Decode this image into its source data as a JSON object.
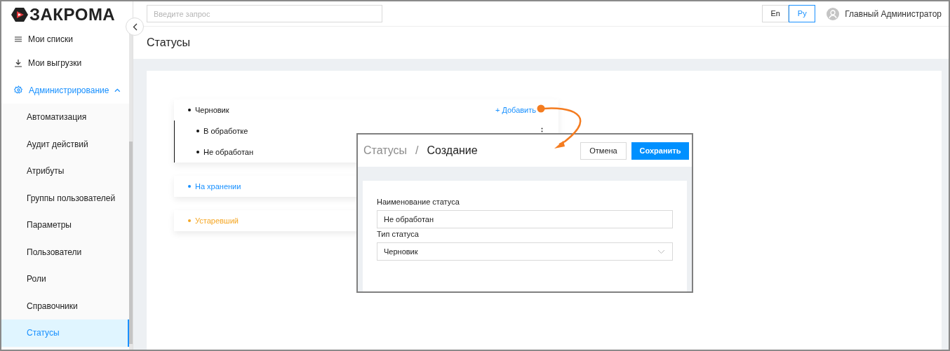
{
  "logo": {
    "text": "ЗАКРОМА"
  },
  "search": {
    "placeholder": "Введите запрос"
  },
  "languages": [
    {
      "label": "En",
      "selected": false
    },
    {
      "label": "Ру",
      "selected": true
    }
  ],
  "user": {
    "name": "Главный Администратор"
  },
  "sidebar": {
    "items": [
      {
        "label": "Мои списки",
        "kind": "list",
        "selected": false
      },
      {
        "label": "Мои выгрузки",
        "kind": "download",
        "selected": false
      },
      {
        "label": "Администрирование",
        "kind": "group",
        "selected": true,
        "expanded": true,
        "children": [
          {
            "label": "Автоматизация",
            "selected": false
          },
          {
            "label": "Аудит действий",
            "selected": false
          },
          {
            "label": "Атрибуты",
            "selected": false
          },
          {
            "label": "Группы пользователей",
            "selected": false
          },
          {
            "label": "Параметры",
            "selected": false
          },
          {
            "label": "Пользователи",
            "selected": false
          },
          {
            "label": "Роли",
            "selected": false
          },
          {
            "label": "Справочники",
            "selected": false
          },
          {
            "label": "Статусы",
            "selected": true
          }
        ]
      }
    ]
  },
  "page_title": "Статусы",
  "statuses": [
    {
      "label": "Черновик",
      "color": "#111111",
      "add_label": "+ Добавить",
      "children": [
        {
          "label": "В обработке",
          "menu": true
        },
        {
          "label": "Не обработан"
        }
      ]
    },
    {
      "label": "На хранении",
      "color": "#1890ff"
    },
    {
      "label": "Устаревший",
      "color": "#f5a623"
    }
  ],
  "dialog": {
    "breadcrumb": "Статусы",
    "separator": "/",
    "title": "Создание",
    "cancel": "Отмена",
    "save": "Сохранить",
    "fields": [
      {
        "label": "Наименование статуса",
        "kind": "text",
        "value": "Не обработан"
      },
      {
        "label": "Тип статуса",
        "kind": "select",
        "value": "Черновик"
      }
    ]
  }
}
